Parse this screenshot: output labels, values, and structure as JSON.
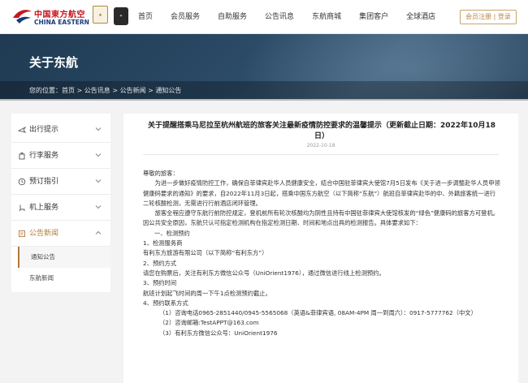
{
  "header": {
    "logo_cn": "中国東方航空",
    "logo_en": "CHINA EASTERN",
    "nav": [
      "首页",
      "会员服务",
      "自助服务",
      "公告讯息",
      "东航商城",
      "集团客户",
      "全球酒店"
    ],
    "login_label": "会员注册 | 登录"
  },
  "banner": {
    "title": "关于东航",
    "breadcrumb_prefix": "您的位置：",
    "breadcrumb": [
      "首页",
      "公告讯息",
      "公告新闻",
      "通知公告"
    ],
    "breadcrumb_sep": " > "
  },
  "sidebar": {
    "items": [
      {
        "label": "出行提示",
        "icon": "plane-icon"
      },
      {
        "label": "行李服务",
        "icon": "luggage-icon"
      },
      {
        "label": "预订指引",
        "icon": "booking-icon"
      },
      {
        "label": "机上服务",
        "icon": "seat-icon"
      },
      {
        "label": "公告新闻",
        "icon": "news-icon"
      }
    ],
    "subitems": [
      "通知公告",
      "东航新闻"
    ]
  },
  "article": {
    "title": "关于提醒搭乘马尼拉至杭州航班的旅客关注最新疫情防控要求的温馨提示（更新截止日期：2022年10月18日）",
    "date": "2022-10-18",
    "paragraphs": [
      {
        "text": "尊敬的旅客：",
        "style": "plain"
      },
      {
        "text": "为进一步做好疫情防控工作，确保自菲律宾赴华人员健康安全，结合中国驻菲律宾大使馆7月5日发布《关于进一步调整赴华人员申领健康码要求的通知》的要求，自2022年11月3日起，搭乘中国东方航空（以下简称“东航”）航班自菲律宾赴华的中、外籍旅客统一进行二轮核酸检测，无需进行行前酒店闭环管理。",
        "style": "indent"
      },
      {
        "text": "旅客全程应遵守东航行前防控规定，登机前所有轮次核酸均为阴性且持有中国驻菲律宾大使馆核发的“绿色”健康码的旅客方可登机。因公共安全原因，东航只认可指定检测机构在指定检测日期、时间和地点出具的检测报告。具体要求如下：",
        "style": "indent"
      },
      {
        "text": "一、检测预约",
        "style": "l1"
      },
      {
        "text": "1、检测服务商",
        "style": "plain"
      },
      {
        "text": "有利东方旅游有限公司（以下简称“有利东方”）",
        "style": "plain"
      },
      {
        "text": "2、预约方式",
        "style": "plain"
      },
      {
        "text": "请您在购票后，关注有利东方微信公众号（UniOrient1976），通过微信进行线上检测预约。",
        "style": "plain"
      },
      {
        "text": "3、预约时间",
        "style": "plain"
      },
      {
        "text": "航班计划起飞时间的周一下午1点检测预约截止。",
        "style": "plain"
      },
      {
        "text": "4、预约联系方式",
        "style": "plain"
      },
      {
        "text": "（1）咨询电话0965-2851440/0945-5565068（英语&菲律宾语, 08AM-4PM 周一到周六）：0917-5777762（中文）",
        "style": "l2"
      },
      {
        "text": "（2）咨询邮箱:TestAPPT@163.com",
        "style": "l2"
      },
      {
        "text": "（3）有利东方微信公众号：UniOrient1976",
        "style": "l2"
      }
    ]
  },
  "colors": {
    "brand_red": "#c8161e",
    "brand_blue": "#1c3a7a",
    "accent_gold": "#b07a3a",
    "banner_bg": "#2b4a66"
  }
}
